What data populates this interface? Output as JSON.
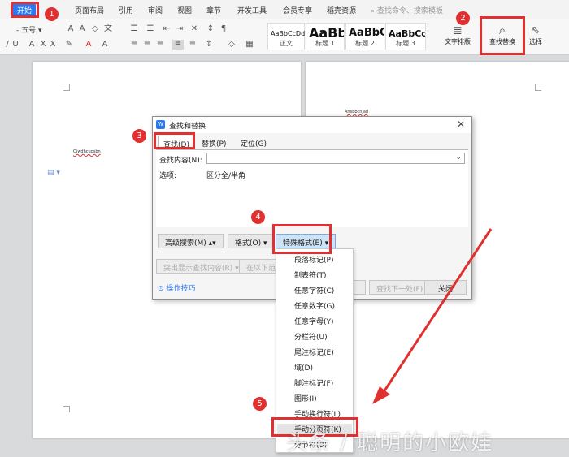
{
  "ribbon_tabs": {
    "start": "开始",
    "layout": "页面布局",
    "reference": "引用",
    "review": "审阅",
    "view": "视图",
    "chapter": "章节",
    "devtools": "开发工具",
    "vip": "会员专享",
    "resources": "稻壳资源",
    "search_placeholder": "查找命令、搜索模板"
  },
  "ribbon": {
    "font_size": "五号",
    "styles": [
      {
        "sample": "AaBbCcDd",
        "label": "正文"
      },
      {
        "sample": "AaBb",
        "label": "标题 1"
      },
      {
        "sample": "AaBbC",
        "label": "标题 2"
      },
      {
        "sample": "AaBbCc",
        "label": "标题 3"
      }
    ],
    "text_layout": "文字排版",
    "find_replace": "查找替换",
    "select": "选择"
  },
  "document": {
    "left_text": "Qiwdhcuosbn",
    "right_text": "Ansbbcnjad"
  },
  "dialog": {
    "title": "查找和替换",
    "tabs": {
      "find": "查找(D)",
      "replace": "替换(P)",
      "goto": "定位(G)"
    },
    "find_label": "查找内容(N):",
    "find_value": "",
    "options_label": "选项:",
    "options_value": "区分全/半角",
    "buttons": {
      "advanced": "高级搜索(M)",
      "format": "格式(O)",
      "special": "特殊格式(E)",
      "highlight": "突出显示查找内容(R)",
      "in_range": "在以下范围",
      "prev": "B)",
      "next": "查找下一处(F)",
      "close": "关闭"
    },
    "tips": "操作技巧"
  },
  "special_menu": [
    "段落标记(P)",
    "制表符(T)",
    "任意字符(C)",
    "任意数字(G)",
    "任意字母(Y)",
    "分栏符(U)",
    "尾注标记(E)",
    "域(D)",
    "脚注标记(F)",
    "图形(I)",
    "手动换行符(L)",
    "手动分页符(K)",
    "分节符(B)"
  ],
  "annotations": {
    "n1": "1",
    "n2": "2",
    "n3": "3",
    "n4": "4",
    "n5": "5"
  },
  "watermark": "头条 / 聪明的小欧娃",
  "colors": {
    "accent": "#2b79f0",
    "highlight": "#e03030",
    "special_btn": "#cfe3f7"
  }
}
